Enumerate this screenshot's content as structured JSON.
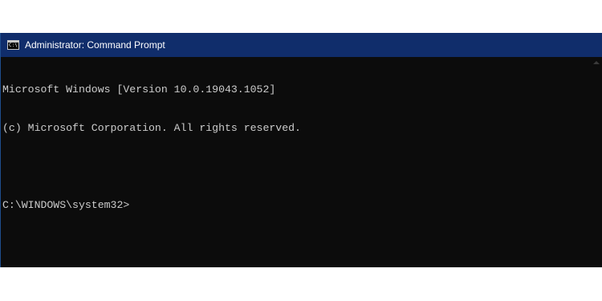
{
  "window": {
    "title": "Administrator: Command Prompt",
    "icon": "cmd-icon",
    "icon_text": "C:\\."
  },
  "console": {
    "lines": [
      "Microsoft Windows [Version 10.0.19043.1052]",
      "(c) Microsoft Corporation. All rights reserved.",
      "",
      "C:\\WINDOWS\\system32>"
    ]
  },
  "colors": {
    "titlebar": "#102d6b",
    "console_background": "#0c0c0c",
    "console_text": "#cccccc"
  }
}
